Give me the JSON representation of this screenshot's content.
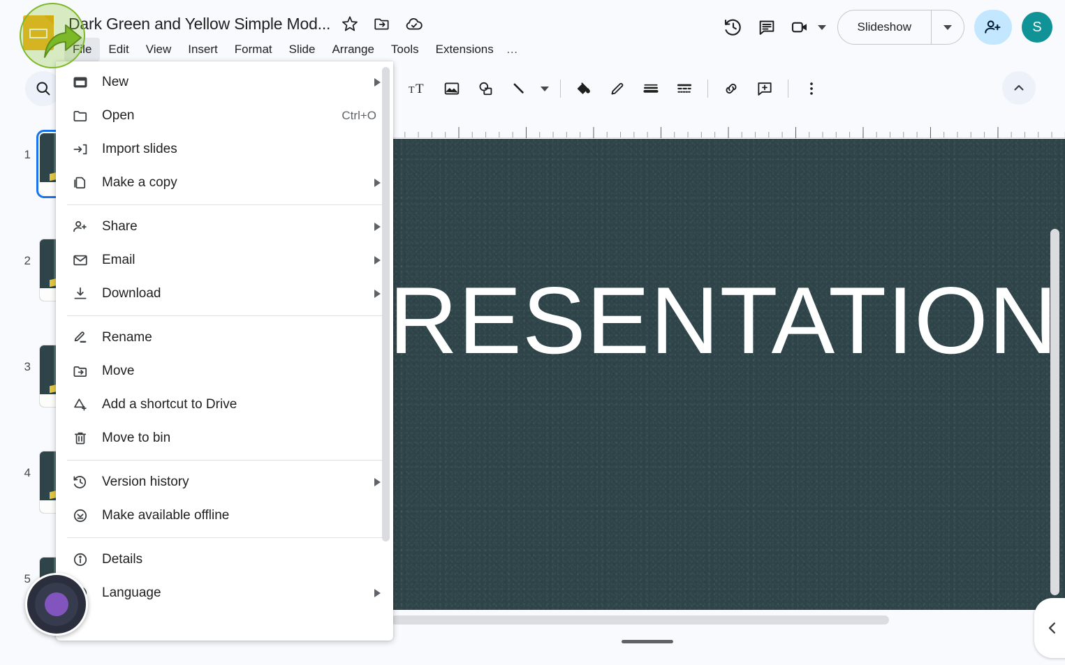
{
  "app": {
    "name": "Google Slides",
    "logo_icon": "slides-logo-icon"
  },
  "header": {
    "doc_title": "Dark Green and Yellow Simple Mod...",
    "title_icons": [
      {
        "name": "star-icon",
        "label": "Star"
      },
      {
        "name": "move-to-folder-icon",
        "label": "Move"
      },
      {
        "name": "saved-to-drive-icon",
        "label": "Saved to Drive"
      }
    ],
    "menus": [
      {
        "label": "File",
        "active": true
      },
      {
        "label": "Edit",
        "active": false
      },
      {
        "label": "View",
        "active": false
      },
      {
        "label": "Insert",
        "active": false
      },
      {
        "label": "Format",
        "active": false
      },
      {
        "label": "Slide",
        "active": false
      },
      {
        "label": "Arrange",
        "active": false
      },
      {
        "label": "Tools",
        "active": false
      },
      {
        "label": "Extensions",
        "active": false
      }
    ],
    "menu_overflow": "…",
    "right_tools": [
      {
        "name": "version-history-icon",
        "label": "Last edit"
      },
      {
        "name": "comment-history-icon",
        "label": "Open comment history"
      },
      {
        "name": "video-camera-icon",
        "label": "Join call"
      }
    ],
    "slideshow_label": "Slideshow",
    "share_label": "Share",
    "avatar_initial": "S",
    "avatar_color": "#0f9396",
    "share_bg_color": "#c2e7ff"
  },
  "toolbar": {
    "search_icon": "search-icon",
    "items": [
      {
        "name": "text-box-icon",
        "label": "Text box"
      },
      {
        "name": "insert-image-icon",
        "label": "Insert image"
      },
      {
        "name": "shape-icon",
        "label": "Shape"
      },
      {
        "name": "line-icon",
        "label": "Line"
      },
      {
        "name": "line-dropdown-caret-icon",
        "label": "Line options"
      },
      {
        "name": "fill-color-icon",
        "label": "Fill colour"
      },
      {
        "name": "border-color-icon",
        "label": "Border colour"
      },
      {
        "name": "border-weight-icon",
        "label": "Border weight"
      },
      {
        "name": "border-dash-icon",
        "label": "Border dash"
      },
      {
        "name": "insert-link-icon",
        "label": "Insert link"
      },
      {
        "name": "add-comment-icon",
        "label": "Add comment"
      },
      {
        "name": "more-options-icon",
        "label": "More"
      }
    ],
    "collapse_icon": "chevron-up-icon"
  },
  "file_menu": {
    "groups": [
      {
        "items": [
          {
            "label": "New",
            "icon": "new-presentation-icon",
            "submenu": true,
            "shortcut": ""
          },
          {
            "label": "Open",
            "icon": "folder-open-icon",
            "submenu": false,
            "shortcut": "Ctrl+O"
          },
          {
            "label": "Import slides",
            "icon": "import-slides-icon",
            "submenu": false,
            "shortcut": ""
          },
          {
            "label": "Make a copy",
            "icon": "copy-icon",
            "submenu": true,
            "shortcut": ""
          }
        ]
      },
      {
        "items": [
          {
            "label": "Share",
            "icon": "person-add-icon",
            "submenu": true,
            "shortcut": ""
          },
          {
            "label": "Email",
            "icon": "email-icon",
            "submenu": true,
            "shortcut": ""
          },
          {
            "label": "Download",
            "icon": "download-icon",
            "submenu": true,
            "shortcut": ""
          }
        ]
      },
      {
        "items": [
          {
            "label": "Rename",
            "icon": "rename-pencil-icon",
            "submenu": false,
            "shortcut": ""
          },
          {
            "label": "Move",
            "icon": "move-folder-icon",
            "submenu": false,
            "shortcut": ""
          },
          {
            "label": "Add a shortcut to Drive",
            "icon": "add-shortcut-drive-icon",
            "submenu": false,
            "shortcut": ""
          },
          {
            "label": "Move to bin",
            "icon": "trash-bin-icon",
            "submenu": false,
            "shortcut": ""
          }
        ]
      },
      {
        "items": [
          {
            "label": "Version history",
            "icon": "version-history-icon",
            "submenu": true,
            "shortcut": ""
          },
          {
            "label": "Make available offline",
            "icon": "offline-check-icon",
            "submenu": false,
            "shortcut": ""
          }
        ]
      },
      {
        "items": [
          {
            "label": "Details",
            "icon": "info-icon",
            "submenu": false,
            "shortcut": ""
          },
          {
            "label": "Language",
            "icon": "language-globe-icon",
            "submenu": true,
            "shortcut": ""
          }
        ]
      }
    ]
  },
  "filmstrip": {
    "slides": [
      {
        "number": "1",
        "selected": true
      },
      {
        "number": "2",
        "selected": false
      },
      {
        "number": "3",
        "selected": false
      },
      {
        "number": "4",
        "selected": false
      },
      {
        "number": "5",
        "selected": false
      }
    ]
  },
  "canvas": {
    "slide_background_color": "#2e4449",
    "slide_title_text": "RESENTATION",
    "slide_title_color": "#ffffff",
    "panel_collapse_icon": "chevron-left-icon"
  },
  "overlays": {
    "click_highlight_color": "#7cb828",
    "recording_indicator_color": "#8155bd"
  }
}
